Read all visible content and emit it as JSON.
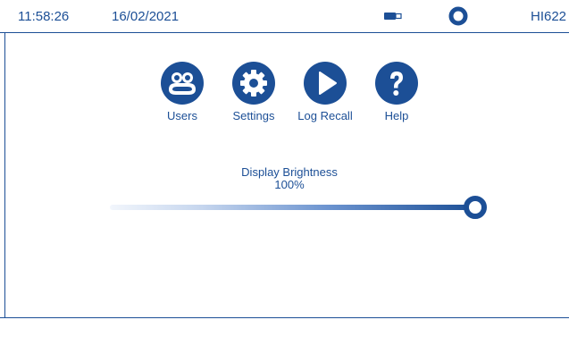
{
  "status_bar": {
    "time": "11:58:26",
    "date": "16/02/2021",
    "model": "HI622",
    "usb_icon": "usb-stick-icon",
    "record_icon": "record-ring-icon"
  },
  "menu": {
    "items": [
      {
        "id": "users",
        "label": "Users",
        "icon": "users-icon"
      },
      {
        "id": "settings",
        "label": "Settings",
        "icon": "gear-icon"
      },
      {
        "id": "log_recall",
        "label": "Log Recall",
        "icon": "play-icon"
      },
      {
        "id": "help",
        "label": "Help",
        "icon": "question-mark-icon"
      }
    ]
  },
  "brightness": {
    "title": "Display Brightness",
    "value_label": "100%",
    "level": 1.0
  },
  "colors": {
    "accent": "#1c4f96",
    "background": "#ffffff"
  }
}
